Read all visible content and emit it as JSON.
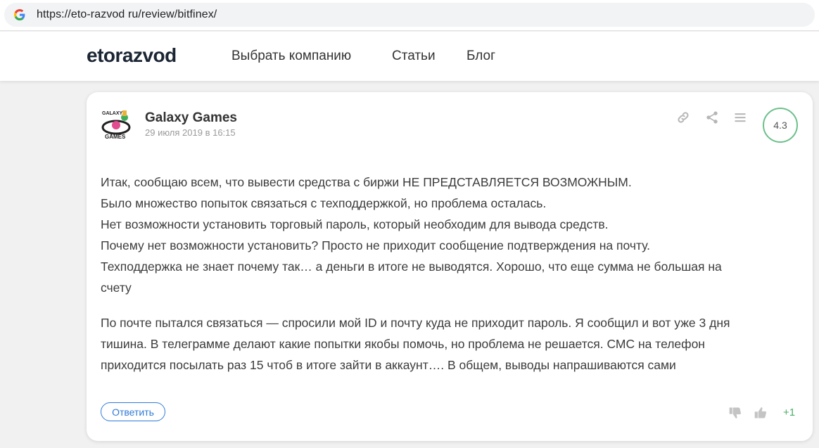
{
  "browser": {
    "url": "https://eto-razvod ru/review/bitfinex/"
  },
  "header": {
    "logo": "etorazvod",
    "nav": [
      "Выбрать компанию",
      "Статьи",
      "Блог"
    ]
  },
  "review": {
    "author": "Galaxy Games",
    "date": "29 июля 2019 в 16:15",
    "rating": "4.3",
    "paragraphs": [
      [
        "Итак, сообщаю всем, что вывести средства с биржи НЕ ПРЕДСТАВЛЯЕТСЯ ВОЗМОЖНЫМ.",
        "Было множество попыток связаться с техподдержкой, но проблема осталась.",
        "Нет возможности установить торговый пароль, который необходим для вывода средств.",
        "Почему нет возможности установить? Просто не приходит сообщение подтверждения на почту.",
        "Техподдержка не знает почему так… а деньги в итоге не выводятся. Хорошо, что еще сумма не большая на",
        "счету"
      ],
      [
        "По почте пытался связаться — спросили мой ID и почту куда не приходит пароль. Я сообщил и вот уже 3 дня",
        "тишина. В телеграмме делают какие попытки якобы помочь, но проблема не решается. СМС на телефон",
        "приходится посылать раз 15 чтоб в итоге зайти в аккаунт…. В общем, выводы напрашиваются сами"
      ]
    ],
    "reply_label": "Ответить",
    "votes": "+1"
  },
  "icons": {
    "browser": "google-g-icon",
    "actions": [
      "link-icon",
      "share-icon",
      "menu-icon"
    ],
    "votes": [
      "thumbs-down-icon",
      "thumbs-up-icon"
    ]
  },
  "colors": {
    "accent_blue": "#2f7bd6",
    "rating_green": "#6cc08b",
    "vote_green": "#4cae6e"
  }
}
